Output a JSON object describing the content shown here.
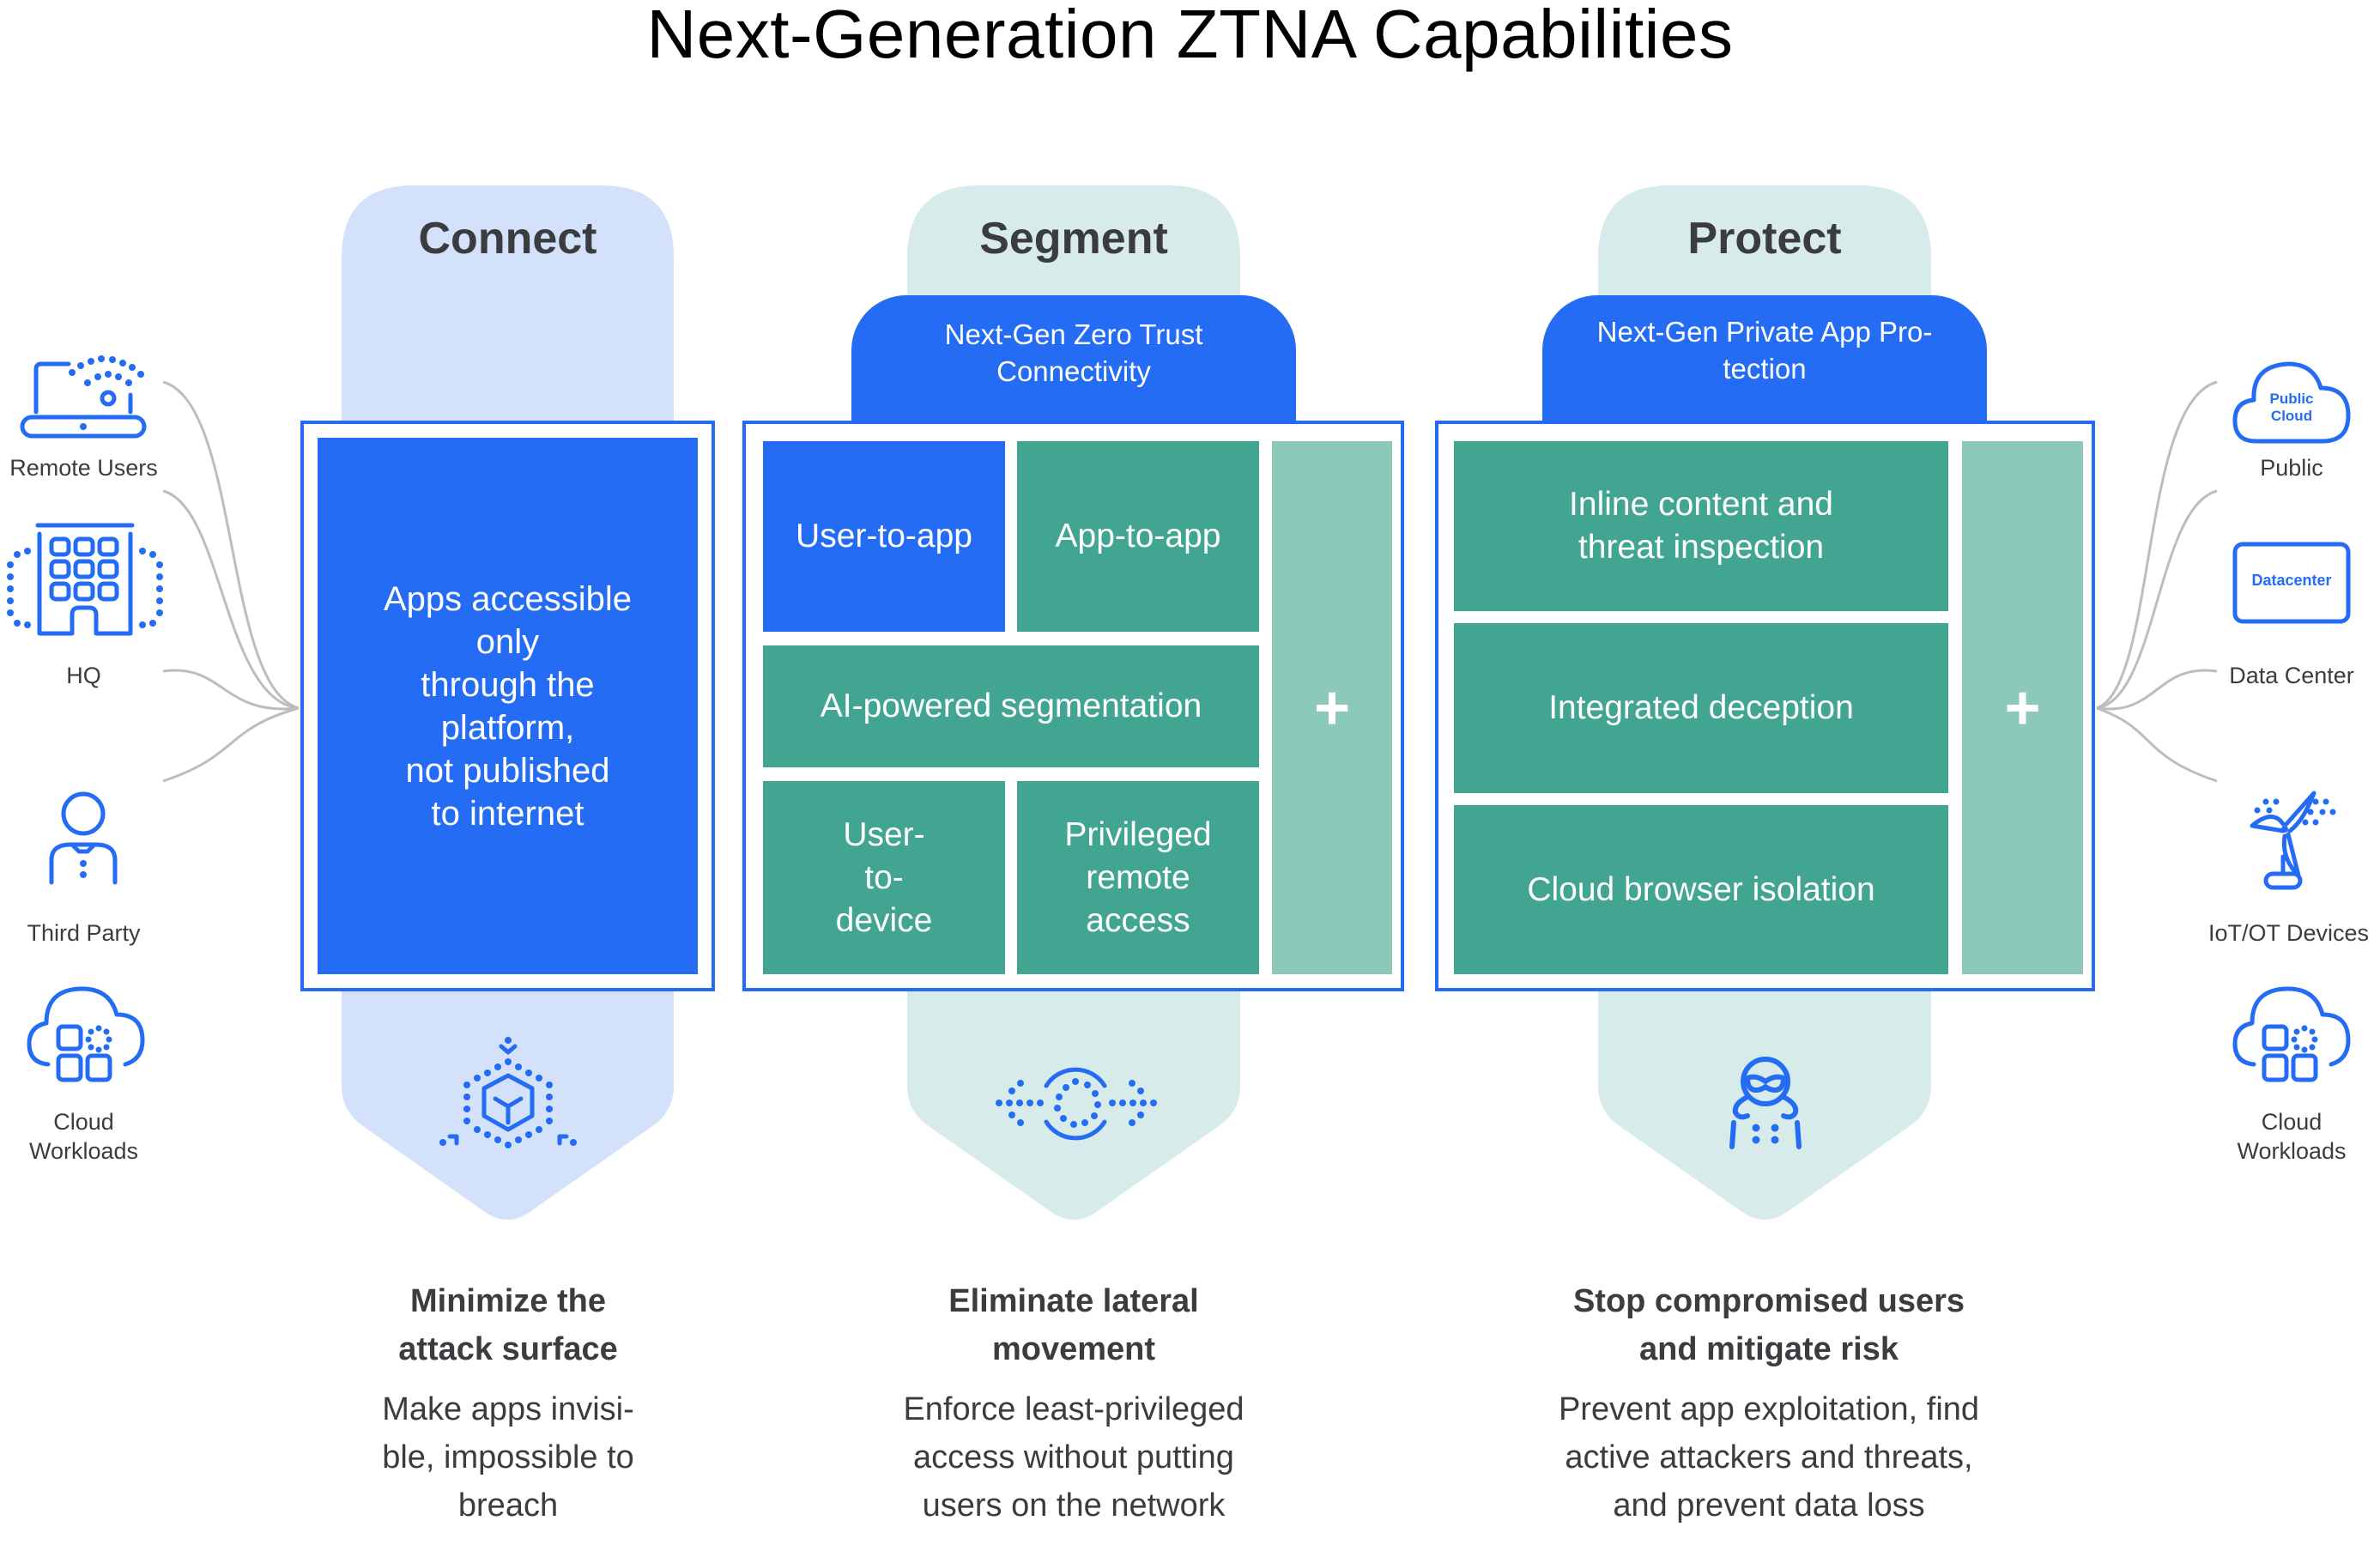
{
  "title": "Next-Generation ZTNA Capabilities",
  "colors": {
    "brand_blue": "#256cf4",
    "teal": "#41a591",
    "light_teal": "#8dc9bb",
    "connect_bg": "#d3e1fb",
    "segment_bg": "#d7ecea",
    "text": "#3b3c40",
    "connector": "#bdbdbd"
  },
  "sources_left": [
    {
      "label": "Remote Users",
      "icon": "laptop-wifi-icon"
    },
    {
      "label": "HQ",
      "icon": "office-building-icon"
    },
    {
      "label": "Third Party",
      "icon": "person-icon"
    },
    {
      "label": "Cloud\nWorkloads",
      "icon": "cloud-workloads-icon"
    }
  ],
  "sources_right": [
    {
      "label": "Public",
      "icon": "public-cloud-icon",
      "icon_text": "Public\nCloud"
    },
    {
      "label": "Data Center",
      "icon": "datacenter-icon",
      "icon_text": "Datacenter"
    },
    {
      "label": "IoT/OT Devices",
      "icon": "wind-turbine-icon"
    },
    {
      "label": "Cloud\nWorkloads",
      "icon": "cloud-workloads-icon"
    }
  ],
  "columns": {
    "connect": {
      "label": "Connect",
      "box_text": "Apps accessible\nonly\nthrough the\nplatform,\nnot published\nto internet",
      "icon": "cube-hexagon-icon",
      "heading": "Minimize the\nattack surface",
      "description": "Make apps invisi-\nble, impossible to\nbreach"
    },
    "segment": {
      "label": "Segment",
      "tab": "Next-Gen Zero Trust\nConnectivity",
      "cells": {
        "user_to_app": "User-to-app",
        "app_to_app": "App-to-app",
        "ai_segmentation": "AI-powered segmentation",
        "user_to_device": "User-\nto-\ndevice",
        "privileged_remote": "Privileged\nremote\naccess",
        "plus": "+"
      },
      "icon": "lateral-movement-icon",
      "heading": "Eliminate lateral\nmovement",
      "description": "Enforce least-privileged\naccess without putting\nusers on the network"
    },
    "protect": {
      "label": "Protect",
      "tab": "Next-Gen Private App Pro-\ntection",
      "cells": {
        "inline_inspection": "Inline content and\nthreat inspection",
        "deception": "Integrated deception",
        "browser_isolation": "Cloud browser isolation",
        "plus": "+"
      },
      "icon": "masked-attacker-icon",
      "heading": "Stop compromised users\nand mitigate risk",
      "description": "Prevent app exploitation, find\nactive attackers and threats,\nand prevent data loss"
    }
  }
}
